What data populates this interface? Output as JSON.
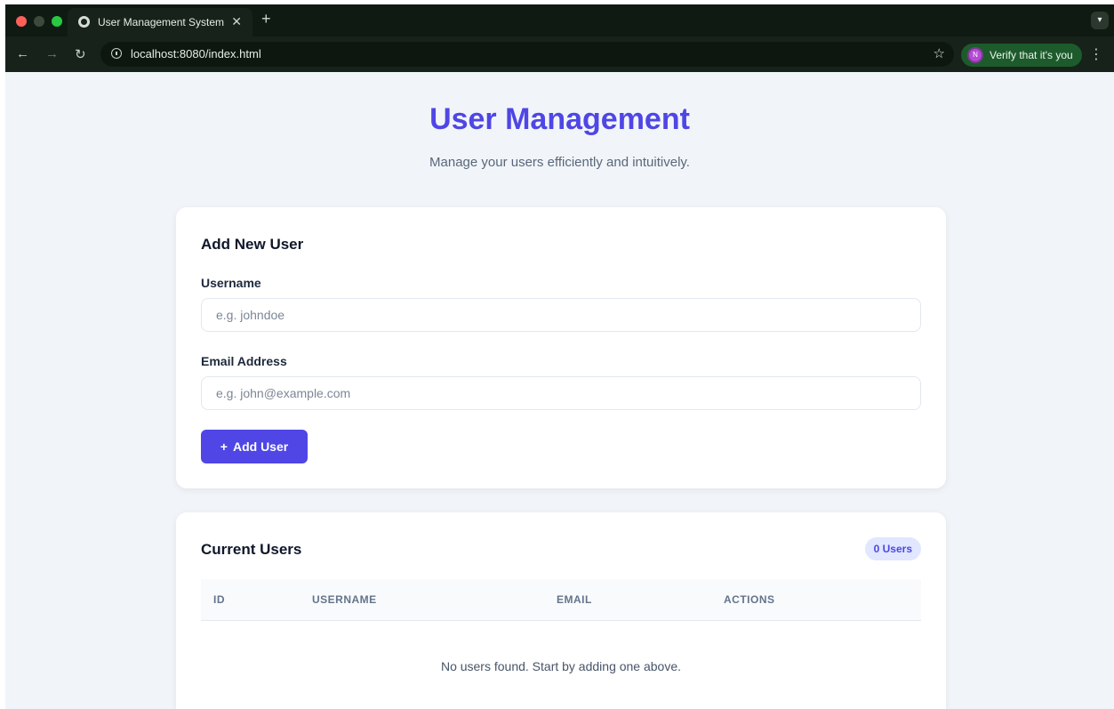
{
  "browser": {
    "tab_title": "User Management System",
    "tab_close_icon": "close-icon",
    "new_tab_icon": "plus-icon",
    "url": "localhost:8080/index.html",
    "verify_label": "Verify that it's you",
    "verify_avatar": "N",
    "accent": "#1d5b2c"
  },
  "header": {
    "title": "User Management",
    "subtitle": "Manage your users efficiently and intuitively."
  },
  "add_user": {
    "heading": "Add New User",
    "username_label": "Username",
    "username_placeholder": "e.g. johndoe",
    "username_value": "",
    "email_label": "Email Address",
    "email_placeholder": "e.g. john@example.com",
    "email_value": "",
    "button_label": "Add User"
  },
  "users": {
    "heading": "Current Users",
    "count_badge": "0 Users",
    "columns": [
      "ID",
      "USERNAME",
      "EMAIL",
      "ACTIONS"
    ],
    "rows": [],
    "empty_message": "No users found. Start by adding one above."
  },
  "colors": {
    "primary": "#4f46e5",
    "page_bg": "#f1f5f9",
    "badge_bg": "#e0e7ff"
  }
}
